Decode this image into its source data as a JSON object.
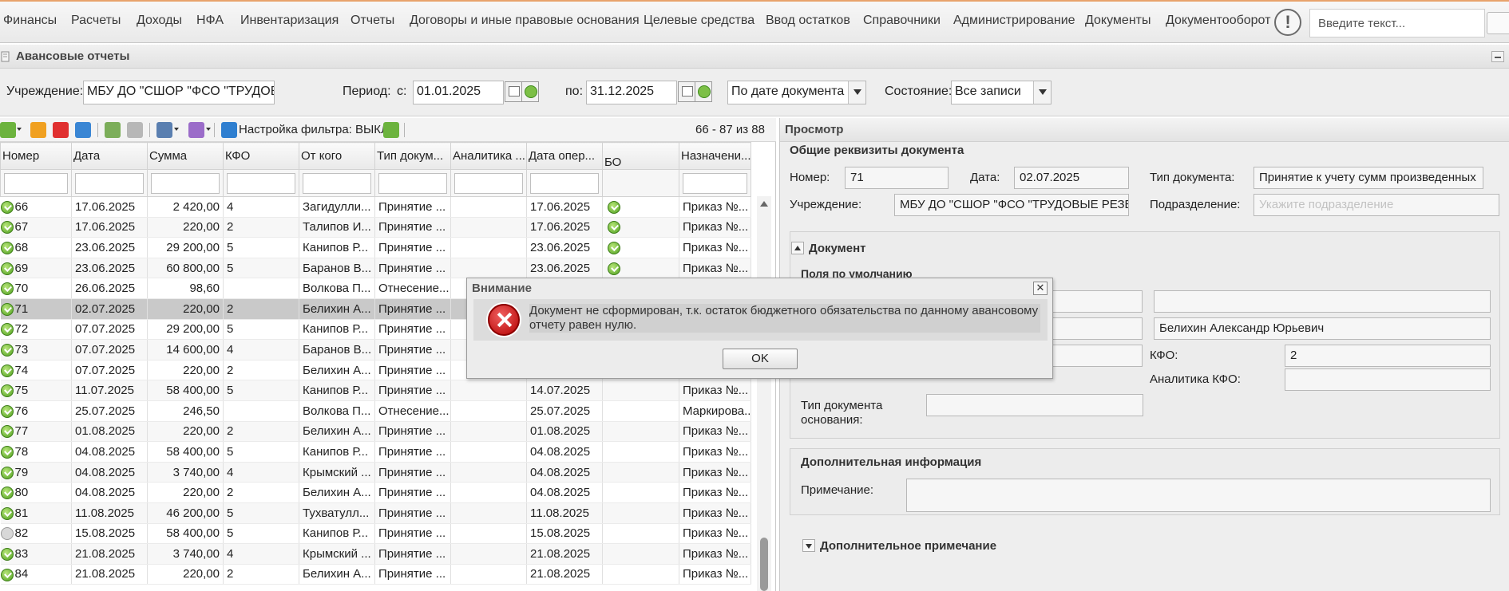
{
  "top_menu": {
    "items": [
      "Финансы",
      "Расчеты",
      "Доходы",
      "НФА",
      "Инвентаризация",
      "Отчеты",
      "Договоры и иные правовые основания",
      "Целевые средства",
      "Ввод остатков",
      "Справочники",
      "Администрирование",
      "Документы",
      "Документооборот"
    ],
    "search_placeholder": "Введите текст..."
  },
  "window": {
    "title": "Авансовые отчеты"
  },
  "filters": {
    "institution_label": "Учреждение:",
    "institution_value": "МБУ ДО \"СШОР \"ФСО \"ТРУДОВЫЕ",
    "period_label": "Период:",
    "from_label": "с:",
    "from_value": "01.01.2025",
    "to_label": "по:",
    "to_value": "31.12.2025",
    "date_mode_value": "По дате документа",
    "state_label": "Состояние:",
    "state_value": "Все записи"
  },
  "toolbar": {
    "filter_setting": "Настройка фильтра: ВЫКЛ",
    "counter": "66 - 87 из 88"
  },
  "grid": {
    "columns": [
      "Номер",
      "Дата",
      "Сумма",
      "КФО",
      "От кого",
      "Тип докум...",
      "Аналитика ...",
      "Дата опер...",
      "БО",
      "Назначени..."
    ],
    "rows": [
      {
        "status": "ok",
        "num": "66",
        "date": "17.06.2025",
        "sum": "2 420,00",
        "kfo": "4",
        "from": "Загидулли...",
        "type": "Принятие ...",
        "analytics": "",
        "opdate": "17.06.2025",
        "bo": "ok",
        "purpose": "Приказ №..."
      },
      {
        "status": "ok",
        "num": "67",
        "date": "17.06.2025",
        "sum": "220,00",
        "kfo": "2",
        "from": "Талипов И...",
        "type": "Принятие ...",
        "analytics": "",
        "opdate": "17.06.2025",
        "bo": "ok",
        "purpose": "Приказ №..."
      },
      {
        "status": "ok",
        "num": "68",
        "date": "23.06.2025",
        "sum": "29 200,00",
        "kfo": "5",
        "from": "Канипов Р...",
        "type": "Принятие ...",
        "analytics": "",
        "opdate": "23.06.2025",
        "bo": "ok",
        "purpose": "Приказ №..."
      },
      {
        "status": "ok",
        "num": "69",
        "date": "23.06.2025",
        "sum": "60 800,00",
        "kfo": "5",
        "from": "Баранов В...",
        "type": "Принятие ...",
        "analytics": "",
        "opdate": "23.06.2025",
        "bo": "ok",
        "purpose": "Приказ №..."
      },
      {
        "status": "ok",
        "num": "70",
        "date": "26.06.2025",
        "sum": "98,60",
        "kfo": "",
        "from": "Волкова П...",
        "type": "Отнесение...",
        "analytics": "",
        "opdate": "",
        "bo": "",
        "purpose": ""
      },
      {
        "status": "ok",
        "num": "71",
        "date": "02.07.2025",
        "sum": "220,00",
        "kfo": "2",
        "from": "Белихин А...",
        "type": "Принятие ...",
        "analytics": "",
        "opdate": "",
        "bo": "",
        "purpose": "",
        "selected": true
      },
      {
        "status": "ok",
        "num": "72",
        "date": "07.07.2025",
        "sum": "29 200,00",
        "kfo": "5",
        "from": "Канипов Р...",
        "type": "Принятие ...",
        "analytics": "",
        "opdate": "",
        "bo": "",
        "purpose": ""
      },
      {
        "status": "ok",
        "num": "73",
        "date": "07.07.2025",
        "sum": "14 600,00",
        "kfo": "4",
        "from": "Баранов В...",
        "type": "Принятие ...",
        "analytics": "",
        "opdate": "",
        "bo": "",
        "purpose": ""
      },
      {
        "status": "ok",
        "num": "74",
        "date": "07.07.2025",
        "sum": "220,00",
        "kfo": "2",
        "from": "Белихин А...",
        "type": "Принятие ...",
        "analytics": "",
        "opdate": "",
        "bo": "",
        "purpose": ""
      },
      {
        "status": "ok",
        "num": "75",
        "date": "11.07.2025",
        "sum": "58 400,00",
        "kfo": "5",
        "from": "Канипов Р...",
        "type": "Принятие ...",
        "analytics": "",
        "opdate": "14.07.2025",
        "bo": "",
        "purpose": "Приказ №..."
      },
      {
        "status": "ok",
        "num": "76",
        "date": "25.07.2025",
        "sum": "246,50",
        "kfo": "",
        "from": "Волкова П...",
        "type": "Отнесение...",
        "analytics": "",
        "opdate": "25.07.2025",
        "bo": "",
        "purpose": "Маркирова..."
      },
      {
        "status": "ok",
        "num": "77",
        "date": "01.08.2025",
        "sum": "220,00",
        "kfo": "2",
        "from": "Белихин А...",
        "type": "Принятие ...",
        "analytics": "",
        "opdate": "01.08.2025",
        "bo": "",
        "purpose": "Приказ №..."
      },
      {
        "status": "ok",
        "num": "78",
        "date": "04.08.2025",
        "sum": "58 400,00",
        "kfo": "5",
        "from": "Канипов Р...",
        "type": "Принятие ...",
        "analytics": "",
        "opdate": "04.08.2025",
        "bo": "",
        "purpose": "Приказ №..."
      },
      {
        "status": "ok",
        "num": "79",
        "date": "04.08.2025",
        "sum": "3 740,00",
        "kfo": "4",
        "from": "Крымский ...",
        "type": "Принятие ...",
        "analytics": "",
        "opdate": "04.08.2025",
        "bo": "",
        "purpose": "Приказ №..."
      },
      {
        "status": "ok",
        "num": "80",
        "date": "04.08.2025",
        "sum": "220,00",
        "kfo": "2",
        "from": "Белихин А...",
        "type": "Принятие ...",
        "analytics": "",
        "opdate": "04.08.2025",
        "bo": "",
        "purpose": "Приказ №..."
      },
      {
        "status": "ok",
        "num": "81",
        "date": "11.08.2025",
        "sum": "46 200,00",
        "kfo": "5",
        "from": "Тухватулл...",
        "type": "Принятие ...",
        "analytics": "",
        "opdate": "11.08.2025",
        "bo": "",
        "purpose": "Приказ №..."
      },
      {
        "status": "grey",
        "num": "82",
        "date": "15.08.2025",
        "sum": "58 400,00",
        "kfo": "5",
        "from": "Канипов Р...",
        "type": "Принятие ...",
        "analytics": "",
        "opdate": "15.08.2025",
        "bo": "",
        "purpose": "Приказ №..."
      },
      {
        "status": "ok",
        "num": "83",
        "date": "21.08.2025",
        "sum": "3 740,00",
        "kfo": "4",
        "from": "Крымский ...",
        "type": "Принятие ...",
        "analytics": "",
        "opdate": "21.08.2025",
        "bo": "",
        "purpose": "Приказ №..."
      },
      {
        "status": "ok",
        "num": "84",
        "date": "21.08.2025",
        "sum": "220,00",
        "kfo": "2",
        "from": "Белихин А...",
        "type": "Принятие ...",
        "analytics": "",
        "opdate": "21.08.2025",
        "bo": "",
        "purpose": "Приказ №..."
      }
    ]
  },
  "preview": {
    "title": "Просмотр",
    "general_section": "Общие реквизиты документа",
    "number_label": "Номер:",
    "number_value": "71",
    "date_label": "Дата:",
    "date_value": "02.07.2025",
    "doctype_label": "Тип документа:",
    "doctype_value": "Принятие к учету сумм произведенных",
    "institution_label": "Учреждение:",
    "institution_value": "МБУ ДО \"СШОР \"ФСО \"ТРУДОВЫЕ РЕЗЕРВ",
    "subdivision_label": "Подразделение:",
    "subdivision_placeholder": "Укажите подразделение",
    "document_section": "Документ",
    "defaults_section": "Поля по умолчанию",
    "person_value": "Белихин Александр Юрьевич",
    "kfo_label": "КФО:",
    "kfo_value": "2",
    "kfo_analytics_label": "Аналитика КФО:",
    "base_doctype_label_1": "Тип документа",
    "base_doctype_label_2": "основания:",
    "additional_section": "Дополнительная информация",
    "note_label": "Примечание:",
    "extra_note_section": "Дополнительное примечание"
  },
  "dialog": {
    "title": "Внимание",
    "message": "Документ не сформирован, т.к. остаток бюджетного обязательства по данному авансовому отчету равен нулю.",
    "ok_label": "OK"
  },
  "colors": {
    "accent_top": "#e8a36c",
    "ok_green": "#4e9f1e",
    "error_red": "#b40000"
  }
}
